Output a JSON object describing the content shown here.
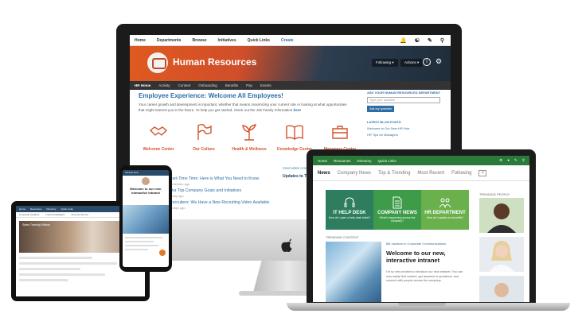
{
  "imac": {
    "topnav": [
      "Home",
      "Departments",
      "Browse",
      "Initiatives",
      "Quick Links"
    ],
    "create_label": "Create",
    "banner_title": "Human Resources",
    "following_label": "Following ▾",
    "actions_label": "Actions ▾",
    "subnav": [
      "HR Home",
      "Activity",
      "Content",
      "Onboarding",
      "Benefits",
      "Pay",
      "Events"
    ],
    "experience_title": "Employee Experience: Welcome All Employees!",
    "experience_body": "Your career growth and development is important, whether that means maximizing your current role or looking at what opportunities that might interest you in the future. To help you get started, check out the Job Family Information",
    "here_link": "here",
    "icons": [
      {
        "label": "Welcome Center",
        "icon": "handshake-icon"
      },
      {
        "label": "Our Culture",
        "icon": "flag-icon"
      },
      {
        "label": "Health & Wellness",
        "icon": "plant-icon"
      },
      {
        "label": "Knowledge Center",
        "icon": "book-icon"
      },
      {
        "label": "Managers Center",
        "icon": "briefcase-icon"
      }
    ],
    "ask_title": "ASK YOUR HUMAN RESOURCES DEPARTMENT",
    "ask_placeholder": "Type your question",
    "ask_button": "Ask my question",
    "blog_title": "LATEST BLOG POSTS",
    "blog_items": [
      "Welcome to Our New HR Hub",
      "HR Tips for Managers"
    ],
    "news": [
      {
        "title": "Part-Time Time: Here is What You Need to Know",
        "time": "2 minutes ago"
      },
      {
        "title": "Our Top Company Goals and Initiatives",
        "time": "1 day ago"
      },
      {
        "title": "Recruiters: We Have a New Recruiting Video Available",
        "time": "2 days ago"
      }
    ],
    "featured_label": "FEATURED CONTENT",
    "featured_title": "Updates to Time Off"
  },
  "laptop": {
    "topnav": [
      "Home",
      "Resources",
      "Directory",
      "Quick Links"
    ],
    "tabs": [
      "News",
      "Company News",
      "Top & Trending",
      "Most Recent",
      "Following"
    ],
    "active_tab": "News",
    "tiles": [
      {
        "title": "IT HELP DESK",
        "sub": "How do I open a help desk ticket?",
        "color": "#2e7d5e",
        "icon": "headset-icon"
      },
      {
        "title": "COMPANY NEWS",
        "sub": "What's happening across the company?",
        "color": "#3d9b4a",
        "icon": "document-icon"
      },
      {
        "title": "HR DEPARTMENT",
        "sub": "How do I update my benefits?",
        "color": "#6ab04c",
        "icon": "people-icon"
      }
    ],
    "trending_label": "TRENDING CONTENT",
    "article_author": "Bill Jackson in Corporate Communications",
    "article_title": "Welcome to our new, interactive intranet",
    "article_body": "I'm so very excited to introduce our new intranet. You can now easily find content, get answers to questions, and connect with people across the company.",
    "people_label": "TRENDING PEOPLE"
  },
  "ipad": {
    "topnav": [
      "Home",
      "Resources",
      "Directory",
      "Quick Links"
    ],
    "tabs": [
      "Corporate Updates",
      "Internal Highlights",
      "Success Stories"
    ],
    "hero_label": "Sales Training Videos"
  },
  "phone": {
    "status": "Intranet Hub",
    "title": "Welcome to our new, interactive intranet"
  }
}
